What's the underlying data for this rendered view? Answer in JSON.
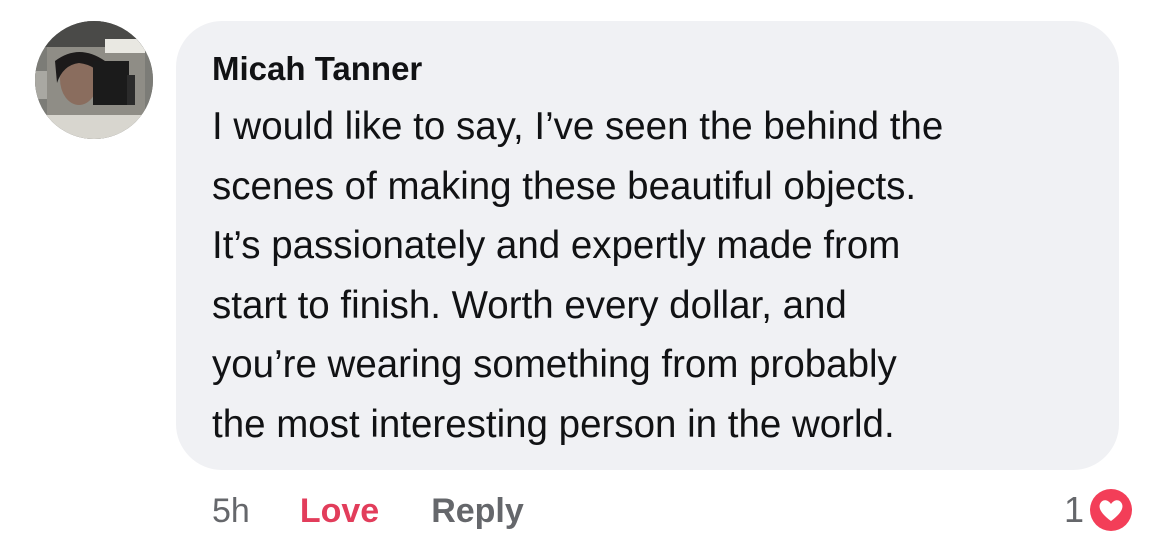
{
  "comment": {
    "author": "Micah Tanner",
    "lines": [
      "I would like to say, I’ve seen the behind the",
      "scenes of making these beautiful objects.",
      "It’s passionately and expertly made from",
      "start to finish. Worth every dollar, and",
      "you’re wearing something from probably",
      "the most interesting person in the world."
    ],
    "avatar_icon": "profile-photo",
    "bubble_color": "#f0f1f4"
  },
  "actions": {
    "time": "5h",
    "love_label": "Love",
    "love_color": "#e23d5b",
    "reply_label": "Reply"
  },
  "reactions": {
    "count": "1",
    "icon": "love-reaction-icon",
    "icon_color": "#f33e58"
  }
}
